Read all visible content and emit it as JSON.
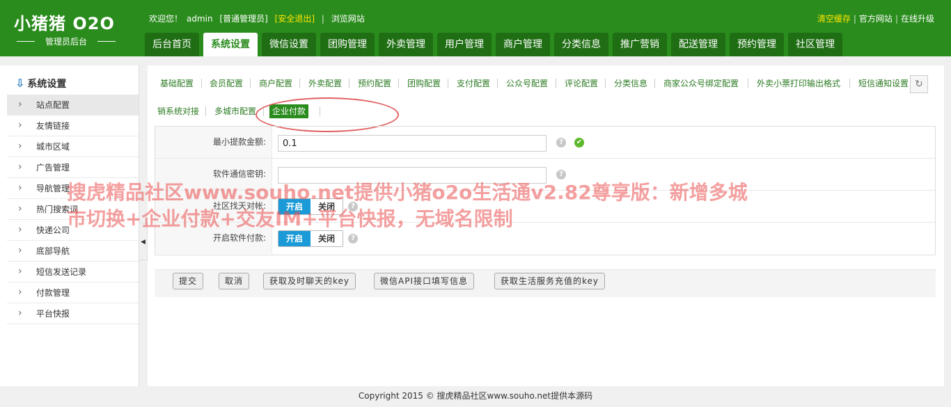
{
  "header": {
    "logo_title": "小猪猪 O2O",
    "logo_subtitle": "管理员后台",
    "welcome": "欢迎您！",
    "username": "admin",
    "role": "[普通管理员]",
    "logout": "[安全退出]",
    "browse_site": "浏览网站",
    "clear_cache": "清空缓存",
    "official_site": "官方网站",
    "online_upgrade": "在线升级",
    "separator": "|",
    "colors": {
      "brand": "#2b8c1e",
      "highlight": "#ffe400"
    }
  },
  "nav": {
    "tabs": [
      "后台首页",
      "系统设置",
      "微信设置",
      "团购管理",
      "外卖管理",
      "用户管理",
      "商户管理",
      "分类信息",
      "推广营销",
      "配送管理",
      "预约管理",
      "社区管理"
    ],
    "active_index": 1
  },
  "sidebar": {
    "title": "系统设置",
    "title_icon": "down-arrow-icon",
    "items": [
      "站点配置",
      "友情链接",
      "城市区域",
      "广告管理",
      "导航管理",
      "热门搜索词",
      "快递公司",
      "底部导航",
      "短信发送记录",
      "付款管理",
      "平台快报"
    ],
    "active_index": 0,
    "collapse_glyph": "◀"
  },
  "subtabs": {
    "items": [
      "基础配置",
      "会员配置",
      "商户配置",
      "外卖配置",
      "预约配置",
      "团购配置",
      "支付配置",
      "公众号配置",
      "评论配置",
      "分类信息",
      "商家公众号绑定配置",
      "外卖小票打印输出格式",
      "短信通知设置",
      "销系统对接",
      "多城市配置",
      "企业付款"
    ],
    "active_index": 15,
    "refresh_glyph": "↻"
  },
  "form": {
    "rows": [
      {
        "label": "最小提款金额:",
        "type": "text",
        "value": "0.1",
        "help": "?",
        "ok": "✔"
      },
      {
        "label": "软件通信密钥:",
        "type": "text",
        "value": "",
        "help": "?"
      },
      {
        "label": "社区找天对帐:",
        "type": "toggle",
        "on": "开启",
        "off": "关闭",
        "help": "?"
      },
      {
        "label": "开启软件付款:",
        "type": "toggle",
        "on": "开启",
        "off": "关闭",
        "help": "?"
      }
    ]
  },
  "buttons": {
    "submit": "提交",
    "cancel": "取消",
    "get_chat_key": "获取及时聊天的key",
    "wechat_api": "微信API接口填写信息",
    "get_life_key": "获取生活服务充值的key"
  },
  "footer": "Copyright 2015 © 搜虎精品社区www.souho.net提供本源码",
  "watermark": {
    "line1": "搜虎精品社区www.souho.net提供小猪o2o生活通v2.82尊享版：新增多城",
    "line2": "市切换+企业付款+交友IM+平台快报，无域名限制"
  }
}
